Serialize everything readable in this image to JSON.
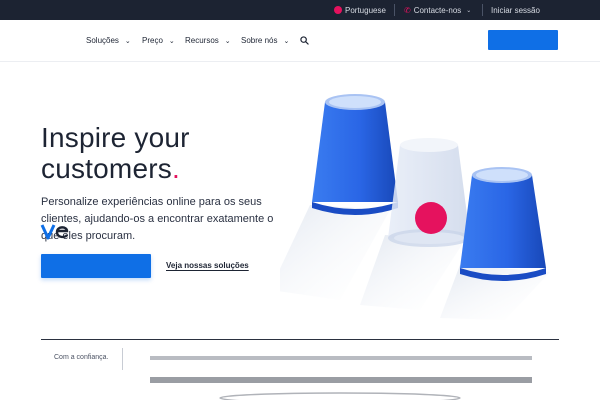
{
  "topbar": {
    "language_label": "Portuguese",
    "contact_label": "Contacte-nos",
    "signin_label": "Iniciar sessão"
  },
  "nav": {
    "items": [
      {
        "label": "Soluções"
      },
      {
        "label": "Preço"
      },
      {
        "label": "Recursos"
      },
      {
        "label": "Sobre nós"
      }
    ],
    "cta_label": ""
  },
  "hero": {
    "title_line1": "Inspire your",
    "title_line2": "customers",
    "title_dot": ".",
    "subtitle": "Personalize experiências online para os seus clientes, ajudando-os a encontrar exatamente o que eles procuram.",
    "primary_button_label": "",
    "secondary_link": "Veja nossas soluções"
  },
  "trust": {
    "label": "Com a confiança."
  },
  "colors": {
    "accent_blue": "#0f6fe6",
    "accent_pink": "#e5125e",
    "topbar_bg": "#1c2332",
    "cup_blue": "#1f5fe0"
  },
  "icons": [
    "globe-icon",
    "phone-icon",
    "chevron-down-icon",
    "search-icon"
  ]
}
